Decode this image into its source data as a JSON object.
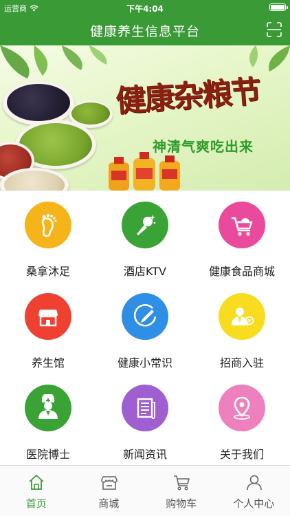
{
  "status_bar": {
    "carrier": "运营商",
    "time": "下午4:04",
    "battery_level": 1.0
  },
  "nav": {
    "title": "健康养生信息平台",
    "right_icon": "scan-icon"
  },
  "banner": {
    "title": "健康杂粮节",
    "subtitle": "神清气爽吃出来"
  },
  "colors": {
    "brand": "#3a9b36",
    "tab_active": "#3a9b36",
    "tab_inactive": "#555555"
  },
  "grid": {
    "items": [
      {
        "label": "桑拿沐足",
        "icon": "foot-icon",
        "color": "#f6b41b"
      },
      {
        "label": "酒店KTV",
        "icon": "microphone-icon",
        "color": "#3aa336"
      },
      {
        "label": "健康食品商城",
        "icon": "shopping-cart-icon",
        "color": "#e94a9b"
      },
      {
        "label": "养生馆",
        "icon": "storefront-icon",
        "color": "#ee4131"
      },
      {
        "label": "健康小常识",
        "icon": "pencil-icon",
        "color": "#2f8ee6"
      },
      {
        "label": "招商入驻",
        "icon": "merchant-icon",
        "color": "#f7dc1f"
      },
      {
        "label": "医院博士",
        "icon": "doctor-icon",
        "color": "#3aa336"
      },
      {
        "label": "新闻资讯",
        "icon": "news-icon",
        "color": "#a05fd0"
      },
      {
        "label": "关于我们",
        "icon": "location-pin-icon",
        "color": "#ee80bd"
      }
    ]
  },
  "tabbar": {
    "tabs": [
      {
        "label": "首页",
        "icon": "home-icon",
        "active": true
      },
      {
        "label": "商城",
        "icon": "store-icon",
        "active": false
      },
      {
        "label": "购物车",
        "icon": "cart-icon",
        "active": false
      },
      {
        "label": "个人中心",
        "icon": "user-icon",
        "active": false
      }
    ]
  }
}
